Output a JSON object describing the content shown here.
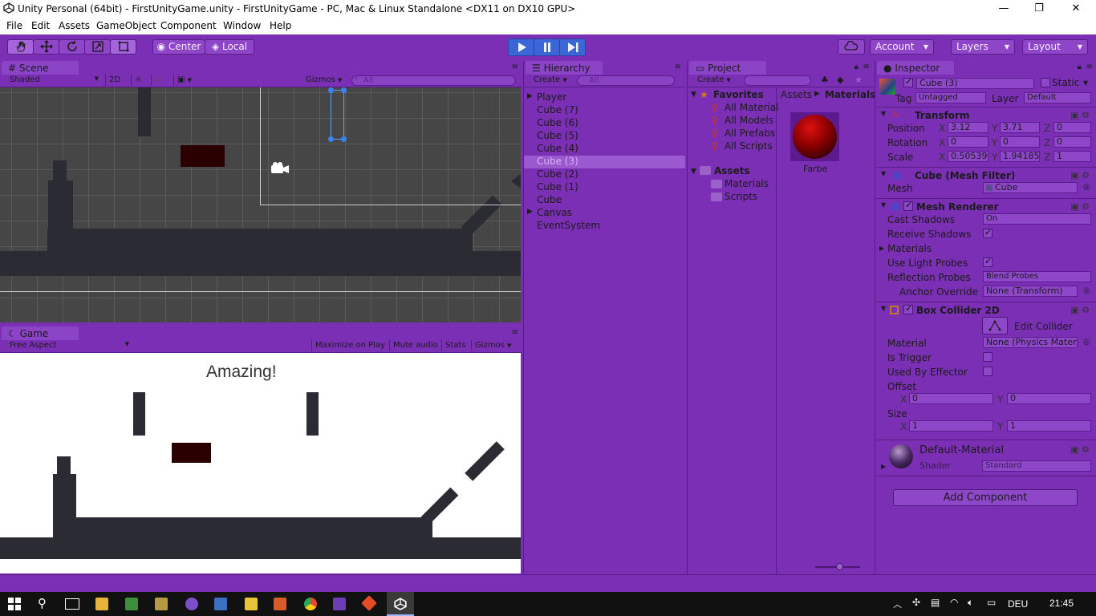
{
  "window": {
    "title": "Unity Personal (64bit) - FirstUnityGame.unity - FirstUnityGame - PC, Mac & Linux Standalone <DX11 on DX10 GPU>",
    "controls": [
      "—",
      "❐",
      "✕"
    ]
  },
  "menu": [
    "File",
    "Edit",
    "Assets",
    "GameObject",
    "Component",
    "Window",
    "Help"
  ],
  "toolbar": {
    "pivot": "Center",
    "space": "Local",
    "account": "Account",
    "layers": "Layers",
    "layout": "Layout"
  },
  "scene_panel": {
    "tab": "Scene",
    "shading": "Shaded",
    "mode_2d": "2D",
    "gizmos": "Gizmos",
    "search_placeholder": "All"
  },
  "game_panel": {
    "tab": "Game",
    "aspect": "Free Aspect",
    "maximize": "Maximize on Play",
    "mute": "Mute audio",
    "stats": "Stats",
    "gizmos": "Gizmos",
    "canvas_text": "Amazing!"
  },
  "hierarchy": {
    "tab": "Hierarchy",
    "create": "Create",
    "search_placeholder": "All",
    "items": [
      {
        "label": "Player",
        "expand": true
      },
      {
        "label": "Cube (7)"
      },
      {
        "label": "Cube (6)"
      },
      {
        "label": "Cube (5)"
      },
      {
        "label": "Cube (4)"
      },
      {
        "label": "Cube (3)",
        "selected": true
      },
      {
        "label": "Cube (2)"
      },
      {
        "label": "Cube (1)"
      },
      {
        "label": "Cube"
      },
      {
        "label": "Canvas",
        "expand": true
      },
      {
        "label": "EventSystem"
      }
    ]
  },
  "project": {
    "tab": "Project",
    "create": "Create",
    "favorites_label": "Favorites",
    "favorites": [
      "All Material",
      "All Models",
      "All Prefabs",
      "All Scripts"
    ],
    "assets_label": "Assets",
    "folders": [
      "Materials",
      "Scripts"
    ],
    "breadcrumb": [
      "Assets",
      "Materials"
    ],
    "asset_name": "Farbe"
  },
  "inspector": {
    "tab": "Inspector",
    "object_name": "Cube (3)",
    "static_label": "Static",
    "tag_label": "Tag",
    "tag_value": "Untagged",
    "layer_label": "Layer",
    "layer_value": "Default",
    "transform": {
      "title": "Transform",
      "position_label": "Position",
      "rotation_label": "Rotation",
      "scale_label": "Scale",
      "position": {
        "x": "3.12",
        "y": "3.71",
        "z": "0"
      },
      "rotation": {
        "x": "0",
        "y": "0",
        "z": "0"
      },
      "scale": {
        "x": "0.50539",
        "y": "1.94185",
        "z": "1"
      }
    },
    "mesh_filter": {
      "title": "Cube (Mesh Filter)",
      "mesh_label": "Mesh",
      "mesh_value": "Cube"
    },
    "mesh_renderer": {
      "title": "Mesh Renderer",
      "cast_shadows_label": "Cast Shadows",
      "cast_shadows_value": "On",
      "receive_shadows_label": "Receive Shadows",
      "materials_label": "Materials",
      "light_probes_label": "Use Light Probes",
      "reflection_probes_label": "Reflection Probes",
      "reflection_probes_value": "Blend Probes",
      "anchor_label": "Anchor Override",
      "anchor_value": "None (Transform)"
    },
    "box_collider": {
      "title": "Box Collider 2D",
      "edit_collider": "Edit Collider",
      "material_label": "Material",
      "material_value": "None (Physics Mater",
      "is_trigger_label": "Is Trigger",
      "used_by_effector_label": "Used By Effector",
      "offset_label": "Offset",
      "offset": {
        "x": "0",
        "y": "0"
      },
      "size_label": "Size",
      "size": {
        "x": "1",
        "y": "1"
      }
    },
    "material": {
      "title": "Default-Material",
      "shader_label": "Shader",
      "shader_value": "Standard"
    },
    "add_component": "Add Component"
  },
  "taskbar": {
    "language": "DEU",
    "time": "21:45"
  },
  "axis_labels": {
    "x": "X",
    "y": "Y",
    "z": "Z"
  },
  "colors": {
    "editor_purple": "#7b2fb5",
    "play_blue": "#3b66d8",
    "scene_bg": "#464646",
    "platform_dark": "#2b2c33",
    "red_block": "#2a0000"
  }
}
